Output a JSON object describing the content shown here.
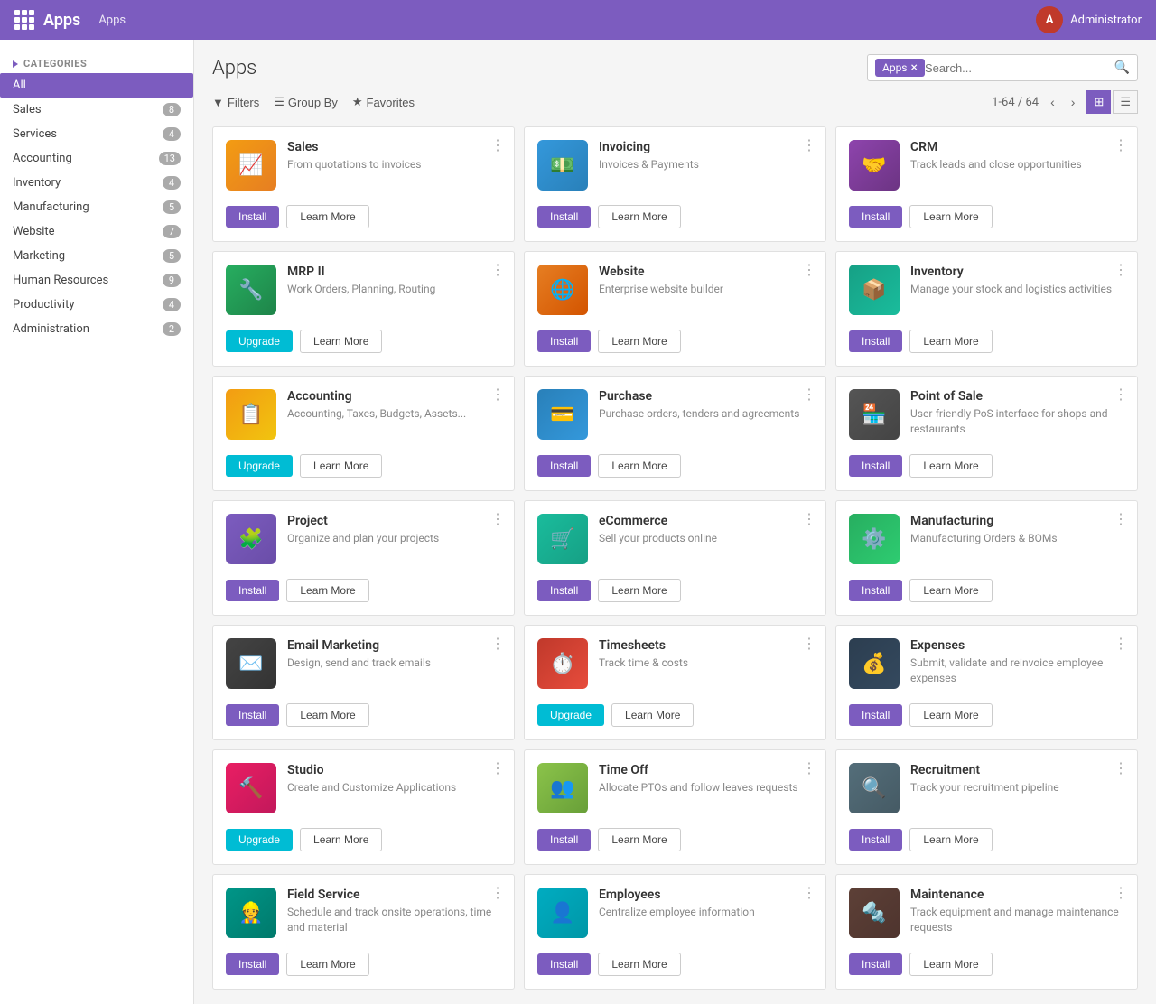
{
  "topbar": {
    "app_grid_label": "Apps",
    "title": "Apps",
    "breadcrumb": "Apps",
    "username": "Administrator",
    "avatar_initial": "A"
  },
  "page": {
    "title": "Apps",
    "search_tag": "Apps",
    "search_placeholder": "Search...",
    "pagination": "1-64 / 64",
    "filters_label": "Filters",
    "groupby_label": "Group By",
    "favorites_label": "Favorites"
  },
  "sidebar": {
    "section_title": "CATEGORIES",
    "items": [
      {
        "label": "All",
        "count": null,
        "active": true
      },
      {
        "label": "Sales",
        "count": "8",
        "active": false
      },
      {
        "label": "Services",
        "count": "4",
        "active": false
      },
      {
        "label": "Accounting",
        "count": "13",
        "active": false
      },
      {
        "label": "Inventory",
        "count": "4",
        "active": false
      },
      {
        "label": "Manufacturing",
        "count": "5",
        "active": false
      },
      {
        "label": "Website",
        "count": "7",
        "active": false
      },
      {
        "label": "Marketing",
        "count": "5",
        "active": false
      },
      {
        "label": "Human Resources",
        "count": "9",
        "active": false
      },
      {
        "label": "Productivity",
        "count": "4",
        "active": false
      },
      {
        "label": "Administration",
        "count": "2",
        "active": false
      }
    ]
  },
  "apps": [
    {
      "name": "Sales",
      "desc": "From quotations to invoices",
      "icon_class": "ic-orange",
      "icon_symbol": "📈",
      "action": "install"
    },
    {
      "name": "Invoicing",
      "desc": "Invoices & Payments",
      "icon_class": "ic-blue",
      "icon_symbol": "💵",
      "action": "install"
    },
    {
      "name": "CRM",
      "desc": "Track leads and close opportunities",
      "icon_class": "ic-purple-inv",
      "icon_symbol": "🤝",
      "action": "install"
    },
    {
      "name": "MRP II",
      "desc": "Work Orders, Planning, Routing",
      "icon_class": "ic-green-mrp",
      "icon_symbol": "🔧",
      "action": "upgrade"
    },
    {
      "name": "Website",
      "desc": "Enterprise website builder",
      "icon_class": "ic-orange-web",
      "icon_symbol": "🌐",
      "action": "install"
    },
    {
      "name": "Inventory",
      "desc": "Manage your stock and logistics activities",
      "icon_class": "ic-teal-inv",
      "icon_symbol": "📦",
      "action": "install"
    },
    {
      "name": "Accounting",
      "desc": "Accounting, Taxes, Budgets, Assets...",
      "icon_class": "ic-amber",
      "icon_symbol": "📋",
      "action": "upgrade"
    },
    {
      "name": "Purchase",
      "desc": "Purchase orders, tenders and agreements",
      "icon_class": "ic-blue-pur",
      "icon_symbol": "💳",
      "action": "install"
    },
    {
      "name": "Point of Sale",
      "desc": "User-friendly PoS interface for shops and restaurants",
      "icon_class": "ic-dark-pos",
      "icon_symbol": "🏪",
      "action": "install"
    },
    {
      "name": "Project",
      "desc": "Organize and plan your projects",
      "icon_class": "ic-purple-proj",
      "icon_symbol": "🧩",
      "action": "install"
    },
    {
      "name": "eCommerce",
      "desc": "Sell your products online",
      "icon_class": "ic-teal-ecom",
      "icon_symbol": "🛒",
      "action": "install"
    },
    {
      "name": "Manufacturing",
      "desc": "Manufacturing Orders & BOMs",
      "icon_class": "ic-green-mfg",
      "icon_symbol": "⚙️",
      "action": "install"
    },
    {
      "name": "Email Marketing",
      "desc": "Design, send and track emails",
      "icon_class": "ic-dark-email",
      "icon_symbol": "✉️",
      "action": "install"
    },
    {
      "name": "Timesheets",
      "desc": "Track time & costs",
      "icon_class": "ic-red-time",
      "icon_symbol": "⏱️",
      "action": "upgrade"
    },
    {
      "name": "Expenses",
      "desc": "Submit, validate and reinvoice employee expenses",
      "icon_class": "ic-blue-exp",
      "icon_symbol": "💰",
      "action": "install"
    },
    {
      "name": "Studio",
      "desc": "Create and Customize Applications",
      "icon_class": "ic-pink-studio",
      "icon_symbol": "🔨",
      "action": "upgrade"
    },
    {
      "name": "Time Off",
      "desc": "Allocate PTOs and follow leaves requests",
      "icon_class": "ic-olive-timeoff",
      "icon_symbol": "👥",
      "action": "install"
    },
    {
      "name": "Recruitment",
      "desc": "Track your recruitment pipeline",
      "icon_class": "ic-gray-rec",
      "icon_symbol": "🔍",
      "action": "install"
    },
    {
      "name": "Field Service",
      "desc": "Schedule and track onsite operations, time and material",
      "icon_class": "ic-teal-field",
      "icon_symbol": "👷",
      "action": "install"
    },
    {
      "name": "Employees",
      "desc": "Centralize employee information",
      "icon_class": "ic-teal-emp",
      "icon_symbol": "👤",
      "action": "install"
    },
    {
      "name": "Maintenance",
      "desc": "Track equipment and manage maintenance requests",
      "icon_class": "ic-dark-maint",
      "icon_symbol": "🔩",
      "action": "install"
    }
  ],
  "labels": {
    "install": "Install",
    "upgrade": "Upgrade",
    "learn_more": "Learn More"
  }
}
